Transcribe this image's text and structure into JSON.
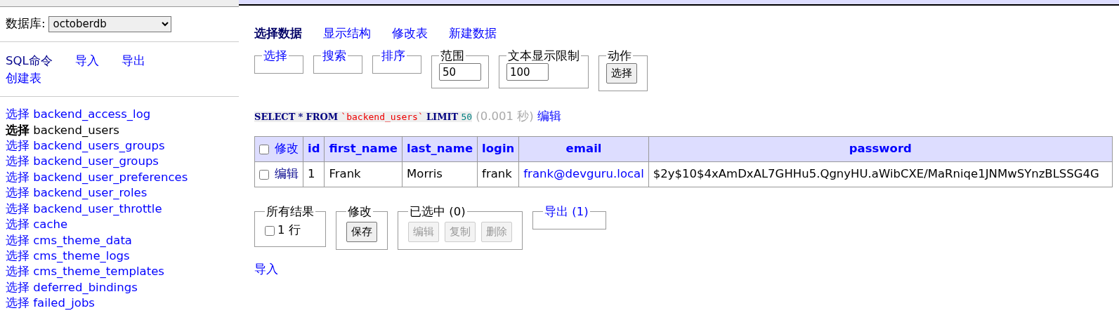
{
  "sidebar": {
    "database_label": "数据库:",
    "database": "octoberdb",
    "links": [
      {
        "label": "SQL命令",
        "selected": true
      },
      {
        "label": "导入",
        "selected": false
      },
      {
        "label": "导出",
        "selected": false
      },
      {
        "label": "创建表",
        "selected": false
      }
    ],
    "tables": [
      {
        "action": "选择",
        "name": "backend_access_log",
        "selected": false
      },
      {
        "action": "选择",
        "name": "backend_users",
        "selected": true
      },
      {
        "action": "选择",
        "name": "backend_users_groups",
        "selected": false
      },
      {
        "action": "选择",
        "name": "backend_user_groups",
        "selected": false
      },
      {
        "action": "选择",
        "name": "backend_user_preferences",
        "selected": false
      },
      {
        "action": "选择",
        "name": "backend_user_roles",
        "selected": false
      },
      {
        "action": "选择",
        "name": "backend_user_throttle",
        "selected": false
      },
      {
        "action": "选择",
        "name": "cache",
        "selected": false
      },
      {
        "action": "选择",
        "name": "cms_theme_data",
        "selected": false
      },
      {
        "action": "选择",
        "name": "cms_theme_logs",
        "selected": false
      },
      {
        "action": "选择",
        "name": "cms_theme_templates",
        "selected": false
      },
      {
        "action": "选择",
        "name": "deferred_bindings",
        "selected": false
      },
      {
        "action": "选择",
        "name": "failed_jobs",
        "selected": false
      }
    ]
  },
  "tabs": [
    {
      "label": "选择数据",
      "selected": true
    },
    {
      "label": "显示结构",
      "selected": false
    },
    {
      "label": "修改表",
      "selected": false
    },
    {
      "label": "新建数据",
      "selected": false
    }
  ],
  "controls": [
    {
      "legend": "选择",
      "kind": "link"
    },
    {
      "legend": "搜索",
      "kind": "link"
    },
    {
      "legend": "排序",
      "kind": "link"
    },
    {
      "legend": "范围",
      "kind": "input",
      "value": "50"
    },
    {
      "legend": "文本显示限制",
      "kind": "input",
      "value": "100"
    },
    {
      "legend": "动作",
      "kind": "button",
      "button": "选择"
    }
  ],
  "query": {
    "tokens": [
      {
        "text": "SELECT",
        "kind": "keyword"
      },
      {
        "text": "*",
        "kind": "keyword"
      },
      {
        "text": "FROM",
        "kind": "keyword"
      },
      {
        "text": "`backend_users`",
        "kind": "identifier"
      },
      {
        "text": "LIMIT",
        "kind": "keyword"
      },
      {
        "text": "50",
        "kind": "number"
      }
    ],
    "timing": "(0.001 秒)",
    "edit_link": "编辑"
  },
  "table": {
    "select_all_checked": false,
    "header_action": "修改",
    "columns": [
      {
        "label": "id",
        "kind": "text"
      },
      {
        "label": "first_name",
        "kind": "text"
      },
      {
        "label": "last_name",
        "kind": "text"
      },
      {
        "label": "login",
        "kind": "text"
      },
      {
        "label": "email",
        "kind": "link"
      },
      {
        "label": "password",
        "kind": "text"
      }
    ],
    "rows": [
      {
        "checked": false,
        "action": "编辑",
        "cells": [
          "1",
          "Frank",
          "Morris",
          "frank",
          "frank@devguru.local",
          "$2y$10$4xAmDxAL7GHHu5.QgnyHU.aWibCXE/MaRniqe1JNMwSYnzBLSSG4G"
        ]
      }
    ]
  },
  "actions": [
    {
      "legend": "所有结果",
      "kind": "checkbox",
      "label": "1 行",
      "checked": false
    },
    {
      "legend": "修改",
      "kind": "buttons",
      "buttons": [
        {
          "label": "保存",
          "disabled": false
        }
      ]
    },
    {
      "legend": "已选中 (0)",
      "kind": "buttons",
      "buttons": [
        {
          "label": "编辑",
          "disabled": true
        },
        {
          "label": "复制",
          "disabled": true
        },
        {
          "label": "删除",
          "disabled": true
        }
      ]
    },
    {
      "legend": "导出 (1)",
      "kind": "link"
    }
  ],
  "import_link": "导入"
}
